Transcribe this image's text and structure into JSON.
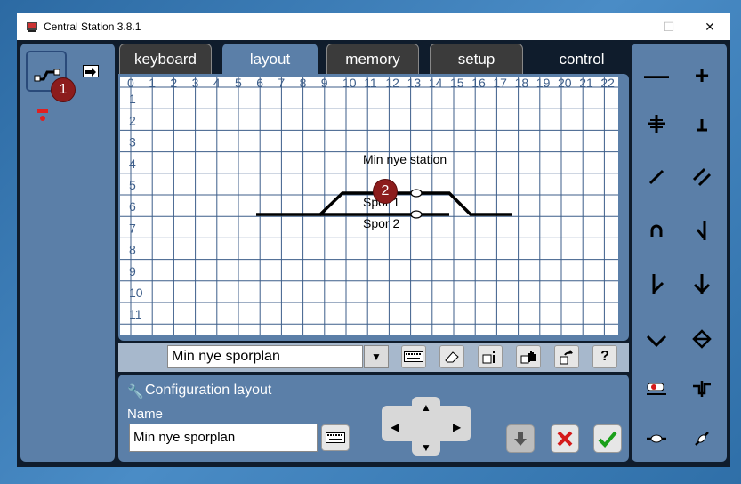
{
  "window": {
    "title": "Central Station 3.8.1"
  },
  "tabs": [
    {
      "label": "keyboard"
    },
    {
      "label": "layout"
    },
    {
      "label": "memory"
    },
    {
      "label": "setup"
    },
    {
      "label": "control"
    }
  ],
  "grid": {
    "col_labels": [
      "0",
      "1",
      "2",
      "3",
      "4",
      "5",
      "6",
      "7",
      "8",
      "9",
      "10",
      "11",
      "12",
      "13",
      "14",
      "15",
      "16",
      "17",
      "18",
      "19",
      "20",
      "21",
      "22"
    ],
    "row_labels": [
      "1",
      "2",
      "3",
      "4",
      "5",
      "6",
      "7",
      "8",
      "9",
      "10",
      "11"
    ],
    "texts": [
      {
        "text": "Min nye station"
      },
      {
        "text": "Spor 1"
      },
      {
        "text": "Spor 2"
      }
    ]
  },
  "badges": {
    "one": "1",
    "two": "2"
  },
  "toolbar": {
    "selected_plan": "Min nye sporplan"
  },
  "config": {
    "title": "Configuration layout",
    "name_label": "Name",
    "name_value": "Min nye sporplan"
  },
  "colors": {
    "panel": "#5b7fa8",
    "badge": "#8c1c1c",
    "accept": "#1aa01a",
    "cancel": "#d41a1a"
  }
}
